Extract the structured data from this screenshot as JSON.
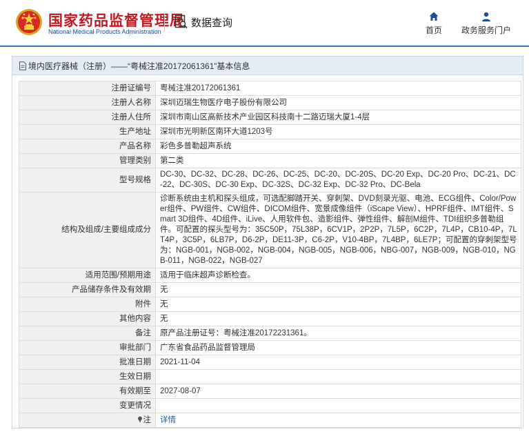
{
  "header": {
    "site_name_cn": "国家药品监督管理局",
    "site_name_en": "National Medical Products Administration",
    "module_title": "数据查询",
    "nav": [
      {
        "label": "首页",
        "icon": "home-icon"
      },
      {
        "label": "政务服务门户",
        "icon": "user-icon"
      }
    ],
    "brand_red": "#c8161d",
    "brand_blue": "#1c4d9c"
  },
  "panel": {
    "title": "境内医疗器械（注册）——“粤械注准20172061361”基本信息"
  },
  "fields": [
    {
      "label": "注册证编号",
      "value": "粤械注准20172061361"
    },
    {
      "label": "注册人名称",
      "value": "深圳迈瑞生物医疗电子股份有限公司"
    },
    {
      "label": "注册人住所",
      "value": "深圳市南山区高新技术产业园区科技南十二路迈瑞大厦1-4层"
    },
    {
      "label": "生产地址",
      "value": "深圳市光明新区南环大道1203号"
    },
    {
      "label": "产品名称",
      "value": "彩色多普勒超声系统"
    },
    {
      "label": "管理类别",
      "value": "第二类"
    },
    {
      "label": "型号规格",
      "value": "DC-30、DC-32、DC-28、DC-26、DC-25、DC-20、DC-20S、DC-20 Exp、DC-20 Pro、DC-21、DC-22、DC-30S、DC-30 Exp、DC-32S、DC-32 Exp、DC-32 Pro、DC-Bela"
    },
    {
      "label": "结构及组成/主要组成成分",
      "value": "诊断系统由主机和探头组成，可选配脚踏开关、穿刺架、DVD刻录光驱、电池、ECG组件、Color/Power组件、PW组件、CW组件、DICOM组件、宽景成像组件（iScape View）、HPRF组件、IMT组件、Smart 3D组件、4D组件、iLive、人用软件包、造影组件、弹性组件、解剖M组件、TDI组织多普勒组件。可配置的探头型号为：35C50P，75L38P，6CV1P，2P2P，7L5P，6C2P，7L4P，CB10-4P，7LT4P，3C5P，6LB7P，D6-2P，DE11-3P，C6-2P，V10-4BP，7L4BP，6LE7P；可配置的穿刺架型号为：NGB-001，NGB-002，NGB-004，NGB-005，NGB-006，NBG-007，NGB-009，NGB-010，NGB-011，NGB-022，NGB-027"
    },
    {
      "label": "适用范围/预期用途",
      "value": "适用于临床超声诊断检查。"
    },
    {
      "label": "产品储存条件及有效期",
      "value": "无"
    },
    {
      "label": "附件",
      "value": "无"
    },
    {
      "label": "其他内容",
      "value": "无"
    },
    {
      "label": "备注",
      "value": "原产品注册证号：粤械注准20172231361。"
    },
    {
      "label": "审批部门",
      "value": "广东省食品药品监督管理局"
    },
    {
      "label": "批准日期",
      "value": "2021-11-04"
    },
    {
      "label": "生效日期",
      "value": ""
    },
    {
      "label": "有效期至",
      "value": "2027-08-07"
    },
    {
      "label": "变更情况",
      "value": ""
    }
  ],
  "note_row": {
    "label": "注",
    "icon": "pin-icon",
    "link_text": "详情"
  }
}
